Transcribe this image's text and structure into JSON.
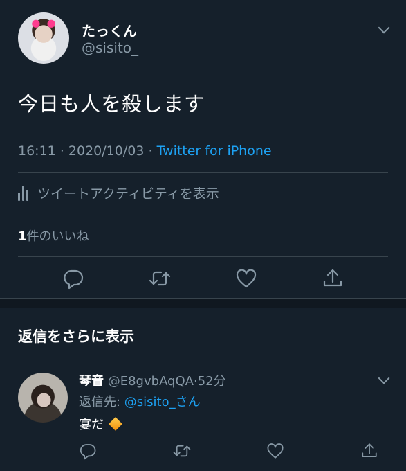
{
  "tweet": {
    "display_name": "たっくん",
    "handle": "@sisito_",
    "text": "今日も人を殺します",
    "time": "16:11",
    "sep1": "·",
    "date": "2020/10/03",
    "sep2": "·",
    "source": "Twitter for iPhone",
    "activity_label": "ツイートアクティビティを表示",
    "likes_count": "1",
    "likes_label": "件のいいね"
  },
  "more_replies_label": "返信をさらに表示",
  "reply": {
    "display_name": "琴音",
    "handle": "@E8gvbAqQA",
    "sep": "·",
    "time_ago": "52分",
    "replying_prefix": "返信先: ",
    "replying_handle": "@sisito_",
    "replying_suffix": "さん",
    "text": "宴だ",
    "emoji": "orange-diamond-emoji"
  },
  "icons": {
    "reply": "reply-icon",
    "retweet": "retweet-icon",
    "like": "heart-icon",
    "share": "share-icon",
    "menu": "chevron-down-icon",
    "activity": "activity-bars-icon"
  },
  "colors": {
    "background": "#15202b",
    "text": "#ffffff",
    "muted": "#8899a6",
    "link": "#1da1f2",
    "divider": "#38444d"
  }
}
